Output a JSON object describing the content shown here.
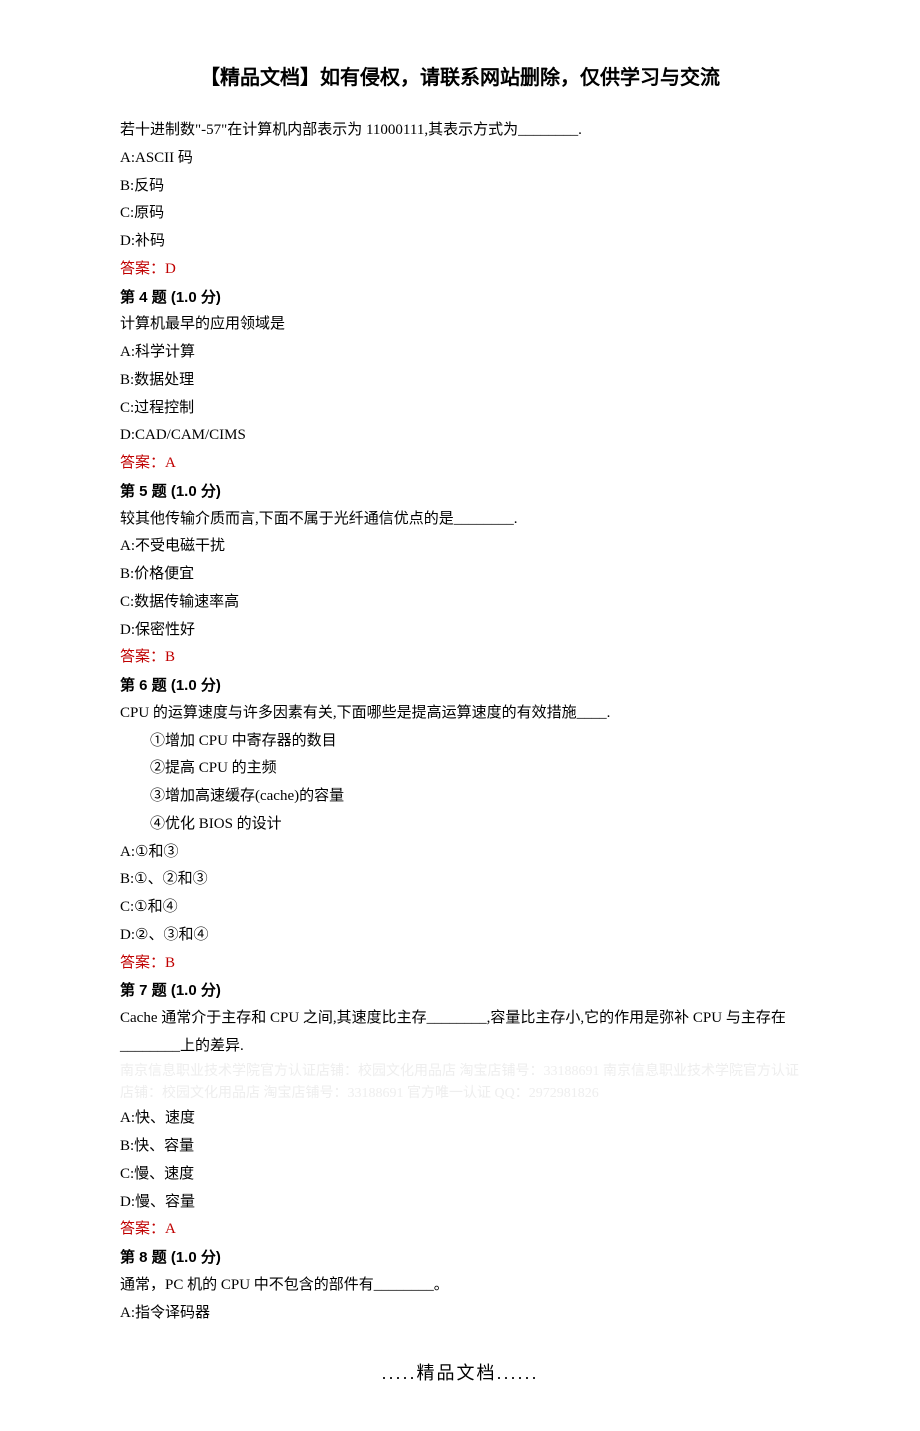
{
  "header": "【精品文档】如有侵权，请联系网站删除，仅供学习与交流",
  "q3": {
    "text": "若十进制数\"-57\"在计算机内部表示为 11000111,其表示方式为________.",
    "a": "A:ASCII 码",
    "b": "B:反码",
    "c": "C:原码",
    "d": "D:补码",
    "ans": "答案：D"
  },
  "q4": {
    "title": "第 4 题   (1.0 分)",
    "text": "计算机最早的应用领域是",
    "a": "A:科学计算",
    "b": "B:数据处理",
    "c": "C:过程控制",
    "d": "D:CAD/CAM/CIMS",
    "ans": "答案：A"
  },
  "q5": {
    "title": "第 5 题   (1.0 分)",
    "text": "较其他传输介质而言,下面不属于光纤通信优点的是________.",
    "a": "A:不受电磁干扰",
    "b": "B:价格便宜",
    "c": "C:数据传输速率高",
    "d": "D:保密性好",
    "ans": "答案：B"
  },
  "q6": {
    "title": "第 6 题   (1.0 分)",
    "text": "CPU 的运算速度与许多因素有关,下面哪些是提高运算速度的有效措施____.",
    "l1": "①增加 CPU 中寄存器的数目",
    "l2": "②提高 CPU 的主频",
    "l3": "③增加高速缓存(cache)的容量",
    "l4": "④优化 BIOS 的设计",
    "a": "A:①和③",
    "b": "B:①、②和③",
    "c": "C:①和④",
    "d": "D:②、③和④",
    "ans": "答案：B"
  },
  "q7": {
    "title": "第 7 题   (1.0 分)",
    "text": "Cache 通常介于主存和 CPU 之间,其速度比主存________,容量比主存小,它的作用是弥补 CPU 与主存在________上的差异.",
    "a": "A:快、速度",
    "b": "B:快、容量",
    "c": "C:慢、速度",
    "d": "D:慢、容量",
    "ans": "答案：A"
  },
  "q8": {
    "title": "第 8 题   (1.0 分)",
    "text": "通常，PC 机的 CPU 中不包含的部件有________。",
    "a": "A:指令译码器"
  },
  "watermark": "南京信息职业技术学院官方认证店铺：校园文化用品店 淘宝店铺号：33188691 南京信息职业技术学院官方认证店铺：校园文化用品店 淘宝店铺号：33188691 官方唯一认证 QQ：2972981826",
  "footer": ".....精品文档......"
}
